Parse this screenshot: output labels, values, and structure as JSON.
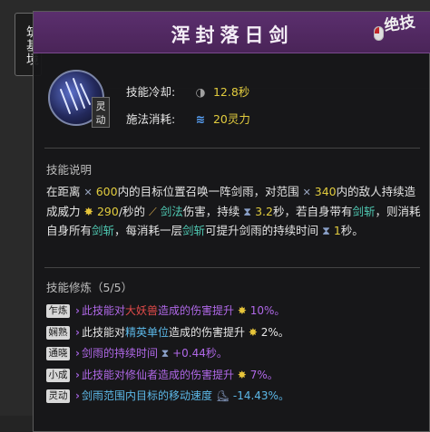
{
  "realm_badge": "筑基境",
  "skill": {
    "name": "浑封落日剑",
    "stamp": "绝技",
    "tag": "灵动",
    "cooldown_label": "技能冷却:",
    "cooldown_value": "12.8秒",
    "cost_label": "施法消耗:",
    "cost_value": "20灵力"
  },
  "description": {
    "section_title": "技能说明",
    "p1": "在距离",
    "range1": "600",
    "p2": "内的目标位置召唤一阵剑雨，对范围",
    "range2": "340",
    "p3": "内的敌人持续造成威力",
    "power": "290",
    "p4": "/秒的",
    "dmg_type": "剑法",
    "p5": "伤害，持续",
    "duration": "3.2",
    "p6": "秒，若自身带有",
    "buff1": "剑斩",
    "p7": "，则消耗自身所有",
    "buff2": "剑斩",
    "p8": "，每消耗一层",
    "buff3": "剑斩",
    "p9": "可提升剑雨的持续时间",
    "extend": "1",
    "p10": "秒。"
  },
  "mods": {
    "section_title": "技能修炼（5/5）",
    "items": [
      {
        "tag": "乍炼",
        "a": "此技能对",
        "b": "大妖兽",
        "c": "造成的伤害提升",
        "val": "10%。"
      },
      {
        "tag": "娴熟",
        "a": "此技能对",
        "b": "精英单位",
        "c": "造成的伤害提升",
        "val": "2%。"
      },
      {
        "tag": "通晓",
        "a": "剑雨的持续时间",
        "val": "+0.44秒。"
      },
      {
        "tag": "小成",
        "a": "此技能对修仙者造成的伤害提升",
        "val": "7%。"
      },
      {
        "tag": "灵动",
        "a": "剑雨范围内目标的移动速度",
        "val": "-14.43%。"
      }
    ]
  },
  "colors": {
    "header": "#5b2f6e",
    "value_yellow": "#e2cc3e",
    "keyword_teal": "#4fc8b2",
    "mod_purple": "#b068e8",
    "mod_red": "#e04a4a",
    "mod_cyan": "#5cb8e8"
  }
}
